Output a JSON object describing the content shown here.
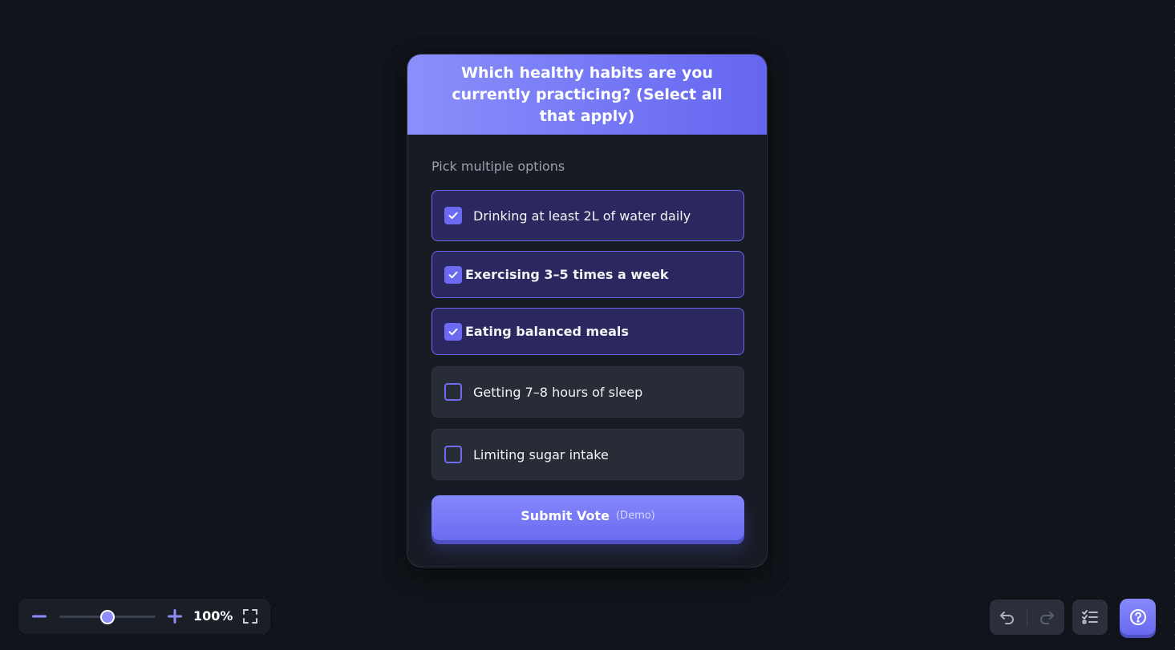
{
  "poll": {
    "question": "Which healthy habits are you currently practicing? (Select all that apply)",
    "subtitle": "Pick multiple options",
    "options": [
      {
        "label": "Drinking at least 2L of water daily",
        "checked": true
      },
      {
        "label": "Exercising 3–5 times a week",
        "checked": true
      },
      {
        "label": "Eating balanced meals",
        "checked": true
      },
      {
        "label": "Getting 7–8 hours of sleep",
        "checked": false
      },
      {
        "label": "Limiting sugar intake",
        "checked": false
      }
    ],
    "submit_label": "Submit Vote",
    "submit_note": "(Demo)"
  },
  "zoom": {
    "value_label": "100%",
    "level": 0.5,
    "minus_icon": "minus-icon",
    "plus_icon": "plus-icon",
    "fullscreen_icon": "fullscreen-icon"
  },
  "toolbar": {
    "undo_icon": "undo-icon",
    "redo_icon": "redo-icon",
    "checklist_icon": "checklist-icon",
    "help_icon": "help-icon"
  },
  "colors": {
    "accent": "#6d6af2",
    "header_start": "#8a8ffb",
    "header_end": "#6466f0",
    "background": "#101319"
  }
}
